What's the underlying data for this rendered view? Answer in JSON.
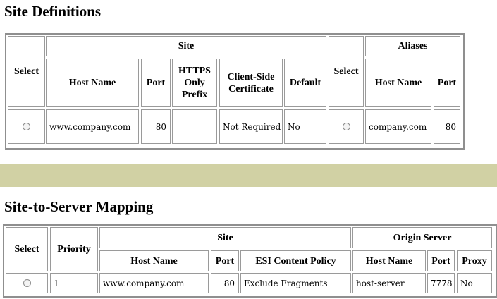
{
  "site_definitions": {
    "title": "Site Definitions",
    "headers": {
      "select": "Select",
      "site": "Site",
      "host_name": "Host Name",
      "port": "Port",
      "https_prefix": "HTTPS Only Prefix",
      "client_cert": "Client-Side Certificate",
      "default": "Default",
      "select2": "Select",
      "aliases": "Aliases",
      "alias_host_name": "Host Name",
      "alias_port": "Port"
    },
    "row": {
      "host_name": "www.company.com",
      "port": "80",
      "https_prefix": "",
      "client_cert": "Not Required",
      "default": "No",
      "alias_host_name": "company.com",
      "alias_port": "80"
    }
  },
  "site_to_server_mapping": {
    "title": "Site-to-Server Mapping",
    "headers": {
      "select": "Select",
      "priority": "Priority",
      "site": "Site",
      "host_name": "Host Name",
      "port": "Port",
      "esi_policy": "ESI Content Policy",
      "origin_server": "Origin Server",
      "origin_host_name": "Host Name",
      "origin_port": "Port",
      "proxy": "Proxy"
    },
    "row": {
      "priority": "1",
      "host_name": "www.company.com",
      "port": "80",
      "esi_policy": "Exclude Fragments",
      "origin_host_name": "host-server",
      "origin_port": "7778",
      "proxy": "No"
    }
  },
  "colors": {
    "band": "#d1d1a4",
    "border": "#8f8f8f"
  }
}
